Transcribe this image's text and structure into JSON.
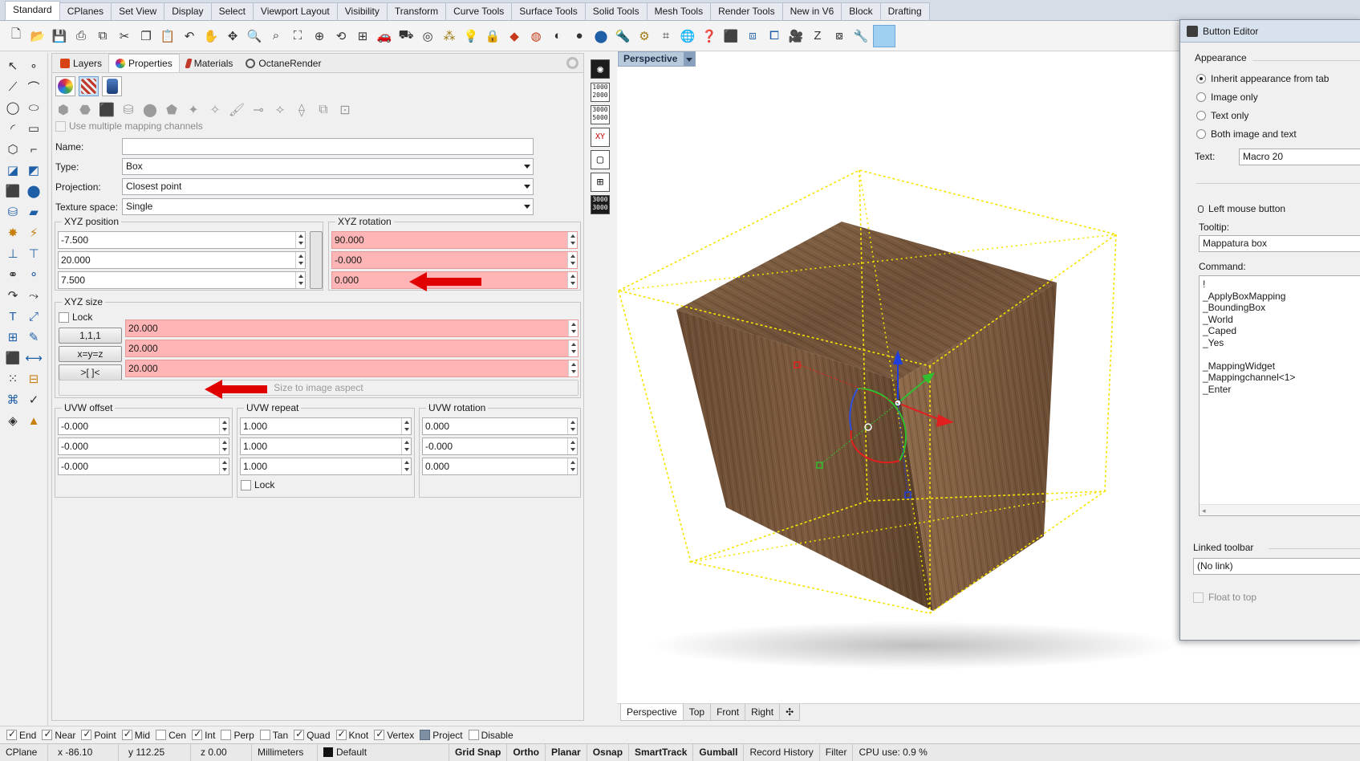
{
  "menu_tabs": [
    "Standard",
    "CPlanes",
    "Set View",
    "Display",
    "Select",
    "Viewport Layout",
    "Visibility",
    "Transform",
    "Curve Tools",
    "Surface Tools",
    "Solid Tools",
    "Mesh Tools",
    "Render Tools",
    "New in V6",
    "Block",
    "Drafting"
  ],
  "panel": {
    "tabs": [
      {
        "label": "Layers",
        "icon": "layers-icon",
        "color": "#d84315"
      },
      {
        "label": "Properties",
        "icon": "properties-icon",
        "color": "#7b3fb5"
      },
      {
        "label": "Materials",
        "icon": "materials-icon",
        "color": "#c0392b"
      },
      {
        "label": "OctaneRender",
        "icon": "octane-icon",
        "color": "#444444"
      }
    ],
    "multi_mapping_label": "Use multiple mapping channels",
    "name_label": "Name:",
    "name_value": "",
    "type_label": "Type:",
    "type_value": "Box",
    "projection_label": "Projection:",
    "projection_value": "Closest point",
    "texture_space_label": "Texture space:",
    "texture_space_value": "Single",
    "xyz_position": {
      "title": "XYZ position",
      "values": [
        "-7.500",
        "20.000",
        "7.500"
      ]
    },
    "xyz_rotation": {
      "title": "XYZ rotation",
      "values": [
        "90.000",
        "-0.000",
        "0.000"
      ]
    },
    "xyz_size": {
      "title": "XYZ size",
      "lock_label": "Lock",
      "buttons": [
        "1,1,1",
        "x=y=z",
        ">[ ]<"
      ],
      "values": [
        "20.000",
        "20.000",
        "20.000"
      ],
      "aspect_button": "Size to image aspect"
    },
    "uvw_offset": {
      "title": "UVW offset",
      "values": [
        "-0.000",
        "-0.000",
        "-0.000"
      ]
    },
    "uvw_repeat": {
      "title": "UVW repeat",
      "values": [
        "1.000",
        "1.000",
        "1.000"
      ],
      "lock_label": "Lock"
    },
    "uvw_rotation": {
      "title": "UVW rotation",
      "values": [
        "0.000",
        "-0.000",
        "0.000"
      ]
    }
  },
  "viewport": {
    "title": "Perspective",
    "tabs": [
      "Perspective",
      "Top",
      "Front",
      "Right"
    ]
  },
  "button_editor": {
    "title": "Button Editor",
    "appearance_label": "Appearance",
    "options": [
      "Inherit appearance from tab",
      "Image only",
      "Text only",
      "Both image and text"
    ],
    "selected_option": 0,
    "text_label": "Text:",
    "text_value": "Macro 20",
    "left_mouse_label": "Left mouse button",
    "tooltip_label": "Tooltip:",
    "tooltip_value": "Mappatura box",
    "command_label": "Command:",
    "command_value": "!\n_ApplyBoxMapping\n_BoundingBox\n_World\n_Caped\n_Yes\n\n_MappingWidget\n_Mappingchannel<1>\n_Enter",
    "linked_toolbar_label": "Linked toolbar",
    "linked_toolbar_value": "(No link)",
    "float_label": "Float to top"
  },
  "snaps": [
    {
      "label": "End",
      "on": true
    },
    {
      "label": "Near",
      "on": true
    },
    {
      "label": "Point",
      "on": true
    },
    {
      "label": "Mid",
      "on": true
    },
    {
      "label": "Cen",
      "on": false
    },
    {
      "label": "Int",
      "on": true
    },
    {
      "label": "Perp",
      "on": false
    },
    {
      "label": "Tan",
      "on": false
    },
    {
      "label": "Quad",
      "on": true
    },
    {
      "label": "Knot",
      "on": true
    },
    {
      "label": "Vertex",
      "on": true
    },
    {
      "label": "Project",
      "on": false
    },
    {
      "label": "Disable",
      "on": false
    }
  ],
  "status": {
    "cplane": "CPlane",
    "x": "x -86.10",
    "y": "y 112.25",
    "z": "z 0.00",
    "units": "Millimeters",
    "layer": "Default",
    "grid_snap": "Grid Snap",
    "ortho": "Ortho",
    "planar": "Planar",
    "osnap": "Osnap",
    "smarttrack": "SmartTrack",
    "gumball": "Gumball",
    "record_history": "Record History",
    "filter": "Filter",
    "cpu": "CPU use: 0.9 %"
  },
  "colors": {
    "highlight_field": "#ffb5b5",
    "annotation_arrow": "#e00000",
    "bounding_box": "#f5e400",
    "wood": "#7a5a3e"
  }
}
